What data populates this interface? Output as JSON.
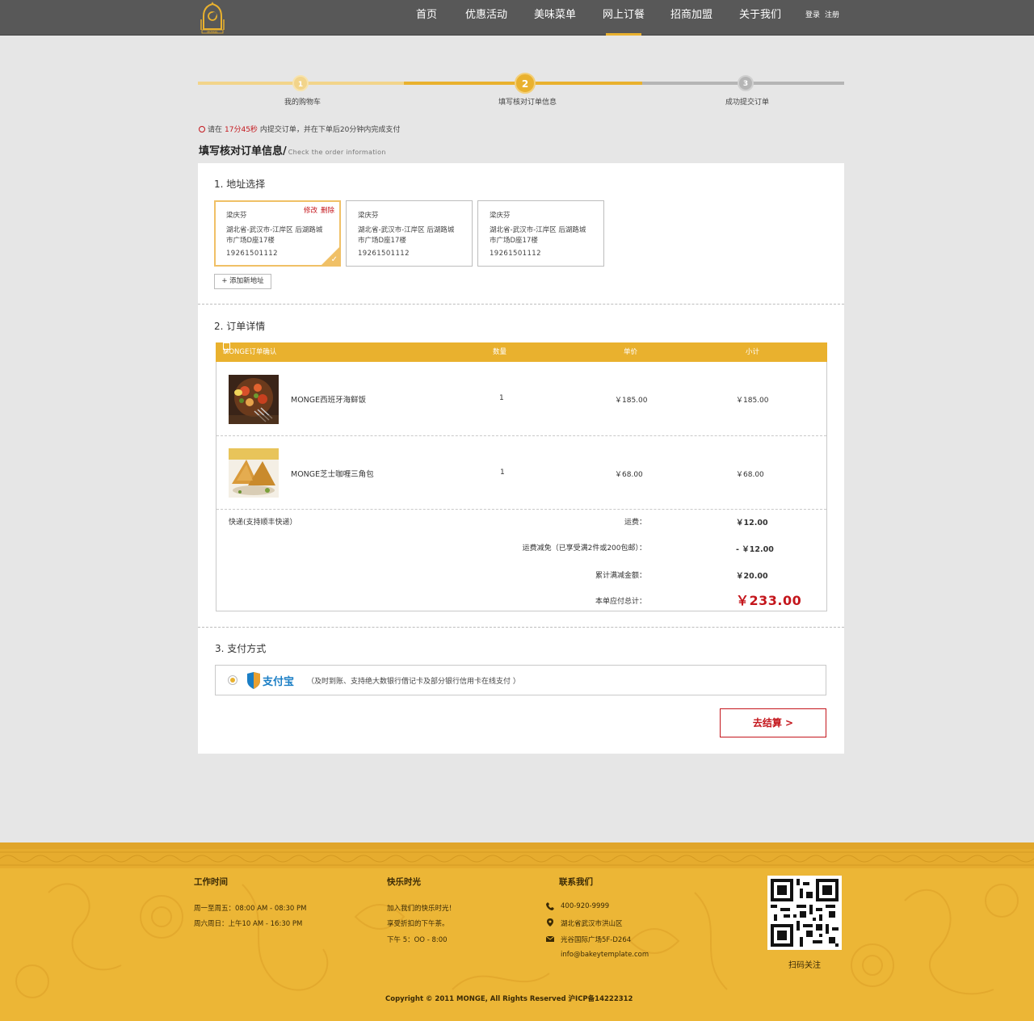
{
  "header": {
    "logo_text": "MONGE",
    "nav": [
      "首页",
      "优惠活动",
      "美味菜单",
      "网上订餐",
      "招商加盟",
      "关于我们"
    ],
    "active_nav": "网上订餐",
    "login": "登录",
    "register": "注册"
  },
  "stepper": {
    "steps": [
      {
        "number": "1",
        "label": "我的购物车"
      },
      {
        "number": "2",
        "label": "填写核对订单信息"
      },
      {
        "number": "3",
        "label": "成功提交订单"
      }
    ],
    "current": 2
  },
  "notice": {
    "prefix": "请在",
    "time": "17分45秒",
    "suffix": "内提交订单，并在下单后20分钟内完成支付"
  },
  "page_title": {
    "zh": "填写核对订单信息/",
    "en": "Check the order information"
  },
  "address_section": {
    "title": "1. 地址选择",
    "edit": "修改",
    "delete": "删除",
    "cards": [
      {
        "name": "梁庆芬",
        "line1": "湖北省-武汉市-江岸区 后湖路城",
        "line2": "市广场D座17楼",
        "phone": "19261501112"
      },
      {
        "name": "梁庆芬",
        "line1": "湖北省-武汉市-江岸区 后湖路城",
        "line2": "市广场D座17楼",
        "phone": "19261501112"
      },
      {
        "name": "梁庆芬",
        "line1": "湖北省-武汉市-江岸区 后湖路城",
        "line2": "市广场D座17楼",
        "phone": "19261501112"
      }
    ],
    "add_button": "+ 添加新地址"
  },
  "order_section": {
    "title": "2. 订单详情",
    "columns": [
      "MONGE订单确认",
      "数量",
      "单价",
      "小计"
    ],
    "items": [
      {
        "name": "MONGE西班牙海鲜饭",
        "qty": "1",
        "price": "￥185.00",
        "subtotal": "￥185.00"
      },
      {
        "name": "MONGE芝士咖喱三角包",
        "qty": "1",
        "price": "￥68.00",
        "subtotal": "￥68.00"
      }
    ],
    "shipping_method": "快递(支持顺丰快递）",
    "summary": {
      "freight_label": "运费：",
      "freight_value": "￥12.00",
      "discount_label": "运费减免（已享受满2件或200包邮）：",
      "discount_value": "- ￥12.00",
      "total_saved_label": "累计满减金额：",
      "total_saved_value": "￥20.00",
      "grand_total_label": "本单应付总计：",
      "grand_total_value": "￥233.00"
    }
  },
  "payment_section": {
    "title": "3. 支付方式",
    "alipay_label": "支付宝",
    "description": "（及时到账、支持绝大数银行借记卡及部分银行信用卡在线支付 ）",
    "checkout_button": "去结算 >"
  },
  "footer": {
    "hours_title": "工作时间",
    "hours": [
      "周一至周五：08:00 AM - 08:30 PM",
      "周六周日：上午10 AM - 16:30 PM"
    ],
    "happy_title": "快乐时光",
    "happy": [
      "加入我们的快乐时光！",
      "享受折扣的下午茶。",
      "下午 5：OO - 8:00"
    ],
    "contact_title": "联系我们",
    "contact": {
      "phone": "400-920-9999",
      "address1": "湖北省武汉市洪山区",
      "address2": "光谷国际广场5F-D264",
      "email": "info@bakeytemplate.com"
    },
    "qr_label": "扫码关注",
    "copyright": "Copyright © 2011 MONGE, All Rights Reserved 沪ICP备14222312"
  },
  "colors": {
    "accent": "#e9b12e",
    "header_bg": "#585858",
    "price_red": "#c4161c",
    "footer_bg": "#ecb636"
  }
}
